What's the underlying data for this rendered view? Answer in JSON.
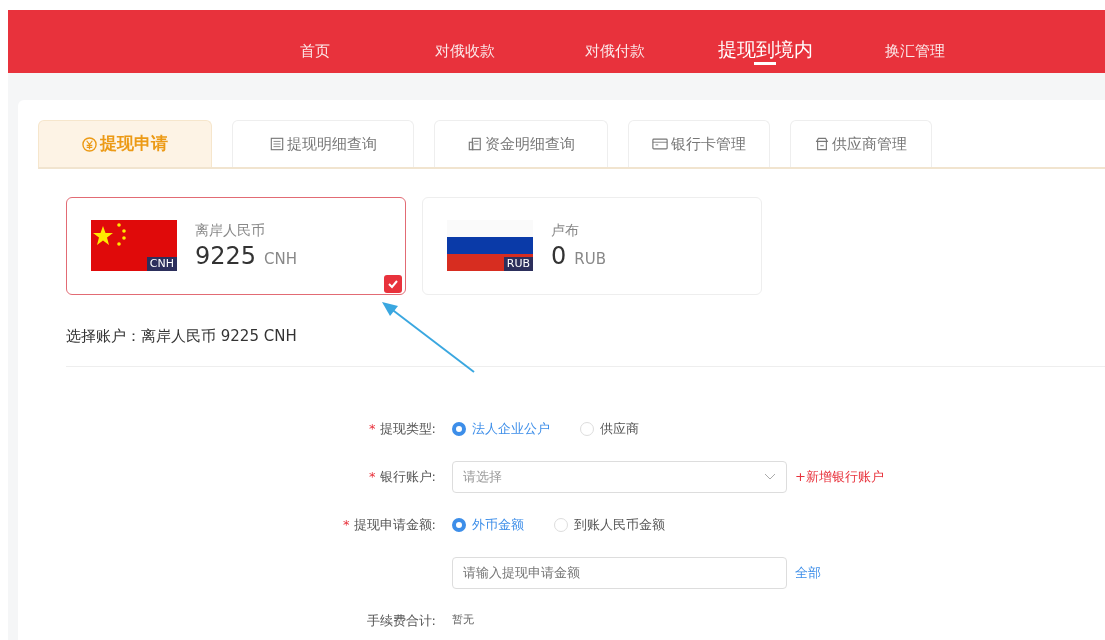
{
  "nav": [
    {
      "label": "首页",
      "selected": false
    },
    {
      "label": "对俄收款",
      "selected": false
    },
    {
      "label": "对俄付款",
      "selected": false
    },
    {
      "label": "提现到境内",
      "selected": true
    },
    {
      "label": "换汇管理",
      "selected": false
    }
  ],
  "tabs": [
    {
      "label": "提现申请",
      "selected": true
    },
    {
      "label": "提现明细查询",
      "selected": false
    },
    {
      "label": "资金明细查询",
      "selected": false
    },
    {
      "label": "银行卡管理",
      "selected": false
    },
    {
      "label": "供应商管理",
      "selected": false
    }
  ],
  "accounts": [
    {
      "kind": "cn",
      "name": "离岸人民币",
      "flag_code": "CNH",
      "amount": "9225",
      "currency": "CNH",
      "selected": true
    },
    {
      "kind": "ru",
      "name": "卢布",
      "flag_code": "RUB",
      "amount": "0",
      "currency": "RUB",
      "selected": false
    }
  ],
  "selection": {
    "label": "选择账户：",
    "value": "离岸人民币 9225  CNH"
  },
  "form": [
    {
      "kind": "radio",
      "mark": "*",
      "label": "提现类型:",
      "options": [
        {
          "label": "法人企业公户",
          "selected": true
        },
        {
          "label": "供应商",
          "selected": false
        }
      ]
    },
    {
      "kind": "select",
      "mark": "*",
      "label": "银行账户:",
      "placeholder": "请选择",
      "link": "+新增银行账户"
    },
    {
      "kind": "radio",
      "mark": "*",
      "label": "提现申请金额:",
      "options": [
        {
          "label": "外币金额",
          "selected": true
        },
        {
          "label": "到账人民币金额",
          "selected": false
        }
      ]
    },
    {
      "kind": "input",
      "placeholder": "请输入提现申请金额",
      "link": "全部"
    },
    {
      "kind": "text",
      "label": "手续费合计:",
      "value": "暂无"
    }
  ]
}
